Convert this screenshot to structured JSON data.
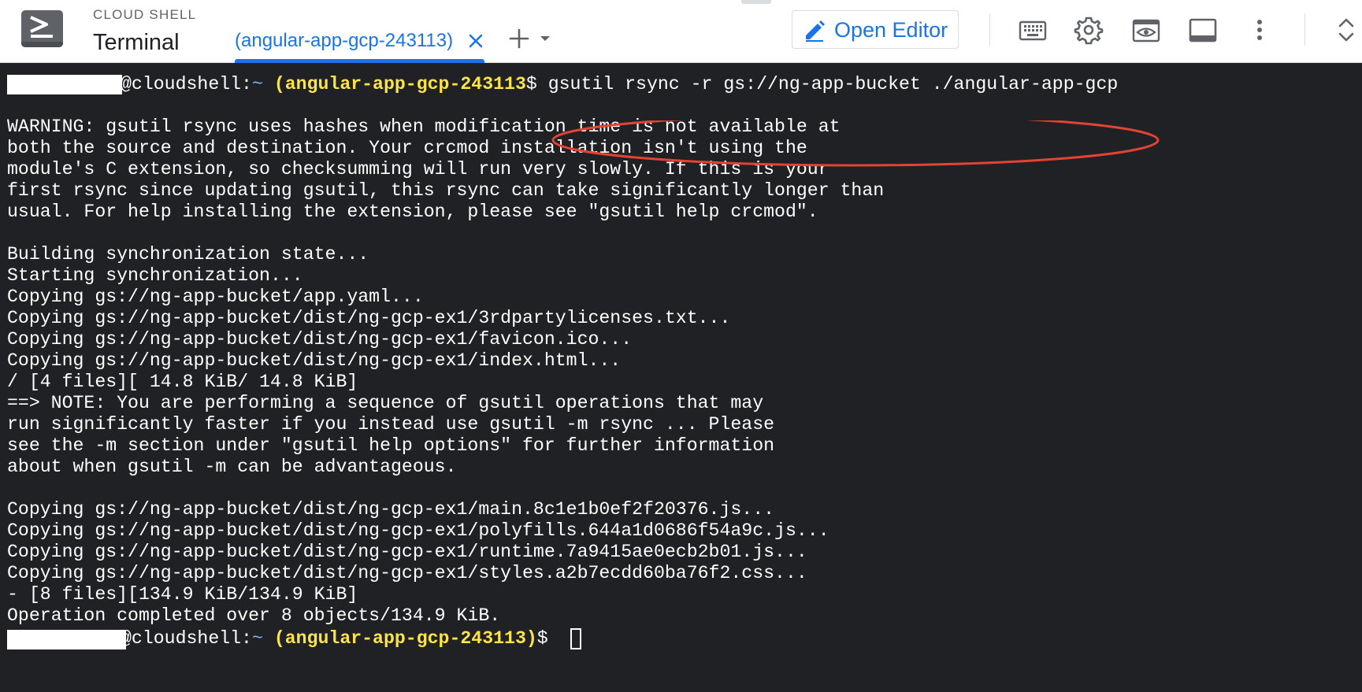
{
  "header": {
    "product_small": "CLOUD SHELL",
    "product_title": "Terminal",
    "tab_label": "(angular-app-gcp-243113)",
    "open_editor_label": "Open Editor",
    "icons": [
      "terminal-app-icon",
      "close-icon",
      "plus-icon",
      "caret-down-icon",
      "pencil-icon",
      "keyboard-icon",
      "gear-icon",
      "web-preview-icon",
      "layout-icon",
      "more-vert-icon",
      "expand-collapse-icon"
    ]
  },
  "terminal": {
    "prompt_host": "@cloudshell:",
    "prompt_tilde": "~",
    "prompt_project": "(angular-app-gcp-243113)",
    "prompt_project_partial": "(angular-app-gcp-243113",
    "prompt_dollar": "$",
    "command": " gsutil rsync -r gs://ng-app-bucket ./angular-app-gcp",
    "output_lines": [
      "",
      "WARNING: gsutil rsync uses hashes when modification time is not available at",
      "both the source and destination. Your crcmod installation isn't using the",
      "module's C extension, so checksumming will run very slowly. If this is your",
      "first rsync since updating gsutil, this rsync can take significantly longer than",
      "usual. For help installing the extension, please see \"gsutil help crcmod\".",
      "",
      "Building synchronization state...",
      "Starting synchronization...",
      "Copying gs://ng-app-bucket/app.yaml...",
      "Copying gs://ng-app-bucket/dist/ng-gcp-ex1/3rdpartylicenses.txt...",
      "Copying gs://ng-app-bucket/dist/ng-gcp-ex1/favicon.ico...",
      "Copying gs://ng-app-bucket/dist/ng-gcp-ex1/index.html...",
      "/ [4 files][ 14.8 KiB/ 14.8 KiB]",
      "==> NOTE: You are performing a sequence of gsutil operations that may",
      "run significantly faster if you instead use gsutil -m rsync ... Please",
      "see the -m section under \"gsutil help options\" for further information",
      "about when gsutil -m can be advantageous.",
      "",
      "Copying gs://ng-app-bucket/dist/ng-gcp-ex1/main.8c1e1b0ef2f20376.js...",
      "Copying gs://ng-app-bucket/dist/ng-gcp-ex1/polyfills.644a1d0686f54a9c.js...",
      "Copying gs://ng-app-bucket/dist/ng-gcp-ex1/runtime.7a9415ae0ecb2b01.js...",
      "Copying gs://ng-app-bucket/dist/ng-gcp-ex1/styles.a2b7ecdd60ba76f2.css...",
      "- [8 files][134.9 KiB/134.9 KiB]",
      "Operation completed over 8 objects/134.9 KiB."
    ]
  },
  "colors": {
    "accent": "#1a73e8",
    "terminal_bg": "#202124",
    "prompt_project": "#fce34a",
    "prompt_tilde": "#8ab4f8",
    "annotation": "#e34234"
  }
}
